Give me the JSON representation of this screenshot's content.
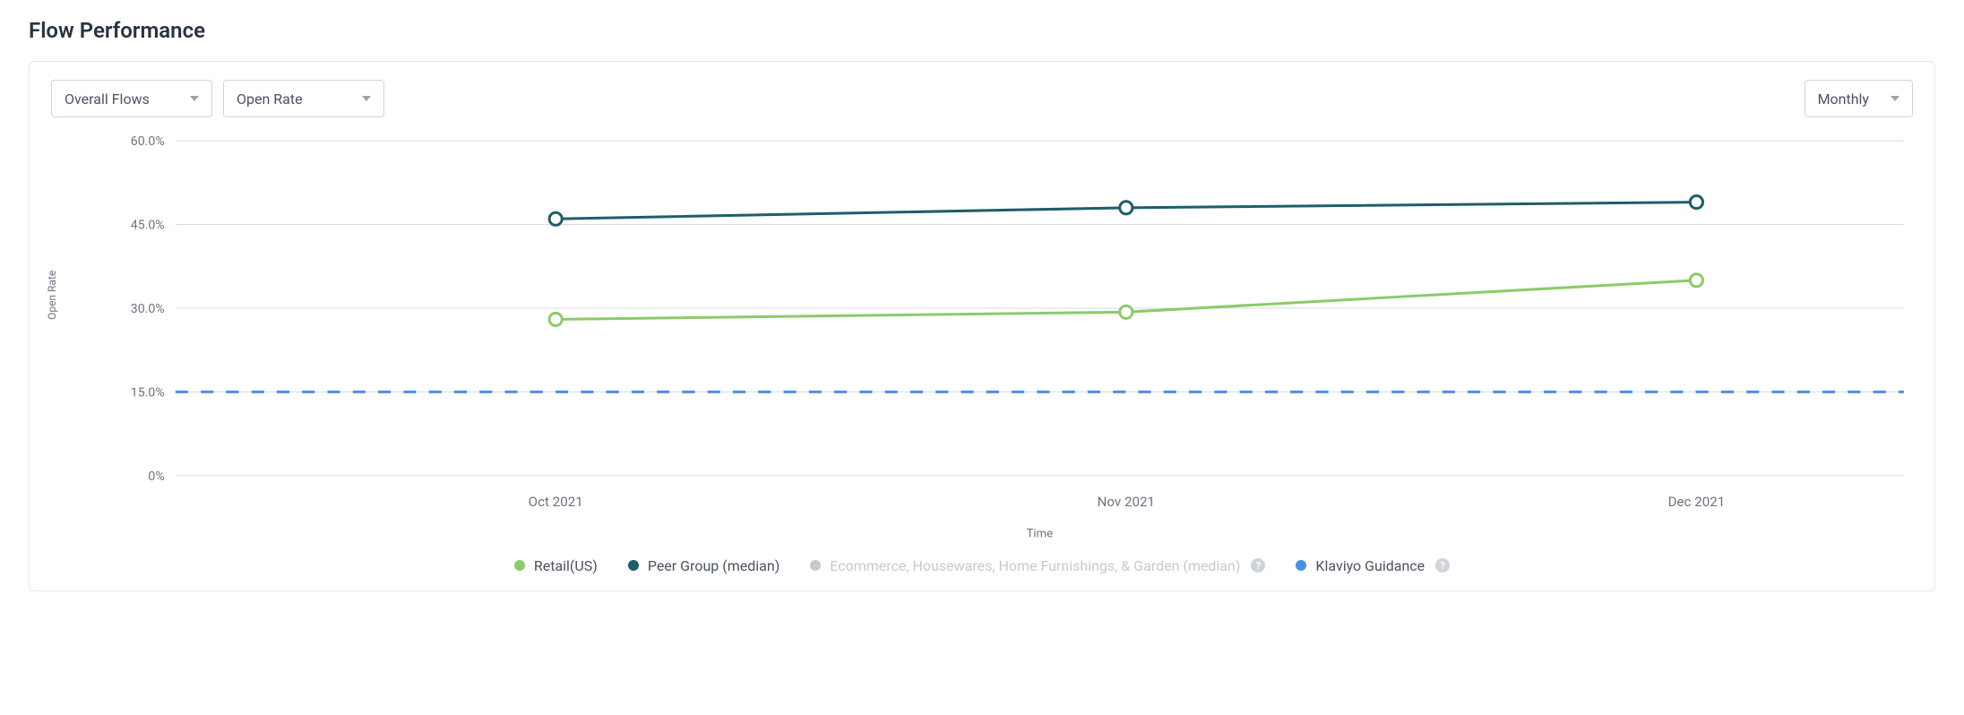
{
  "title": "Flow Performance",
  "toolbar": {
    "flow_select": "Overall Flows",
    "metric_select": "Open Rate",
    "period_select": "Monthly"
  },
  "chart_data": {
    "type": "line",
    "title": "",
    "xlabel": "Time",
    "ylabel": "Open Rate",
    "ylim": [
      0,
      60
    ],
    "yticks": [
      0,
      15,
      30,
      45,
      60
    ],
    "ytick_labels": [
      "0%",
      "15.0%",
      "30.0%",
      "45.0%",
      "60.0%"
    ],
    "categories": [
      "Oct 2021",
      "Nov 2021",
      "Dec 2021"
    ],
    "guidance": 15.0,
    "series": [
      {
        "name": "Retail(US)",
        "color": "#8bcb6b",
        "values": [
          28.0,
          29.3,
          35.0
        ]
      },
      {
        "name": "Peer Group (median)",
        "color": "#1f5d6b",
        "values": [
          46.0,
          48.0,
          49.0
        ]
      },
      {
        "name": "Ecommerce, Housewares, Home Furnishings, & Garden (median)",
        "color": "#c5cad1",
        "values": null,
        "muted": true,
        "help": true
      },
      {
        "name": "Klaviyo Guidance",
        "color": "#4a90e2",
        "values": null,
        "is_guidance": true,
        "help": true
      }
    ]
  }
}
